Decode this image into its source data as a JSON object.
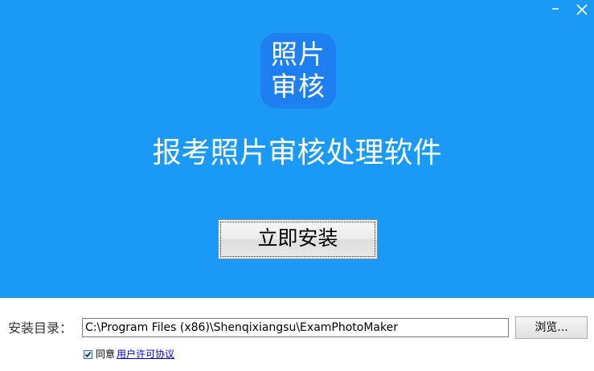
{
  "window": {
    "minimize_icon": "minimize-icon",
    "close_icon": "close-icon"
  },
  "hero": {
    "background_color": "#1a9af5",
    "logo": {
      "line1": "照片",
      "line2": "审核",
      "color": "#1e7ff0"
    },
    "title": "报考照片审核处理软件",
    "install_label": "立即安装"
  },
  "install_dir": {
    "label": "安装目录：",
    "value": "C:\\Program Files (x86)\\Shenqixiangsu\\ExamPhotoMaker",
    "browse_label": "浏览..."
  },
  "agreement": {
    "checked": true,
    "text": "同意",
    "link_label": "用户许可协议"
  }
}
